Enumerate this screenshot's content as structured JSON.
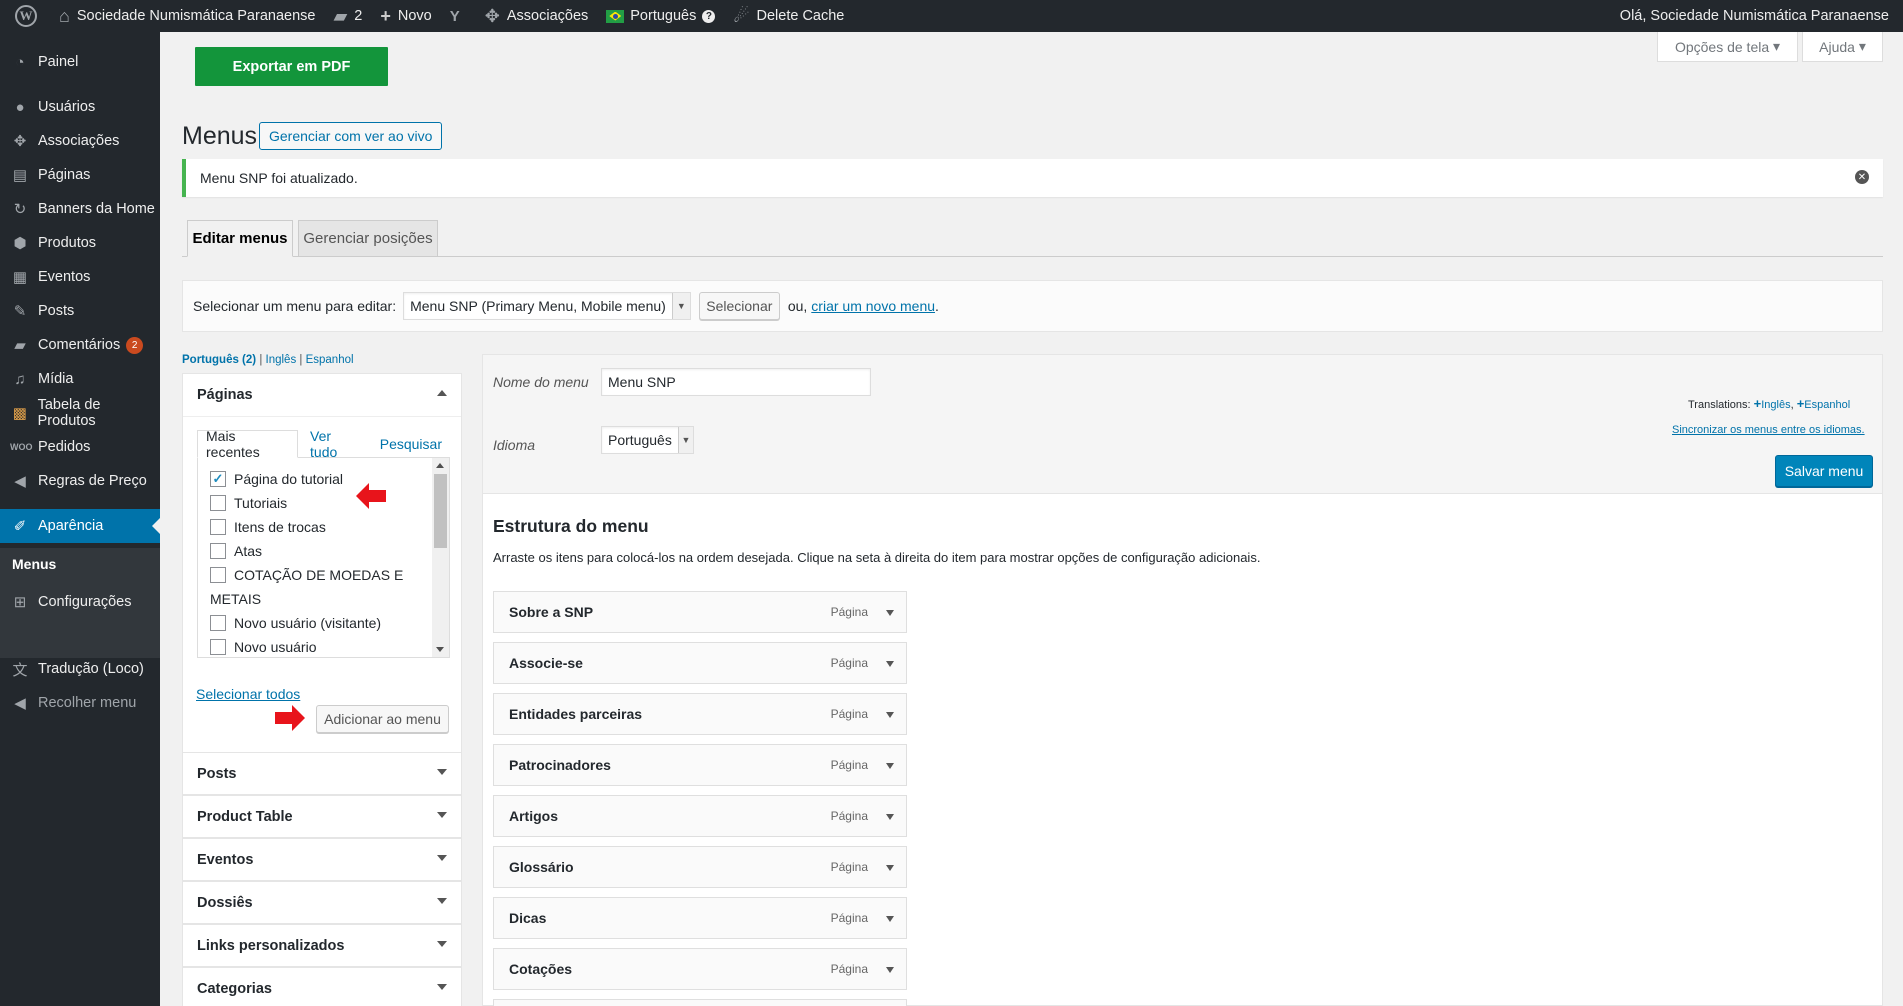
{
  "adminbar": {
    "site_name": "Sociedade Numismática Paranaense",
    "comments_count": "2",
    "new_label": "Novo",
    "associations": "Associações",
    "language": "Português",
    "delete_cache": "Delete Cache",
    "greeting": "Olá, Sociedade Numismática Paranaense"
  },
  "sidebar": {
    "painel": "Painel",
    "usuarios": "Usuários",
    "associacoes": "Associações",
    "paginas": "Páginas",
    "banners": "Banners da Home",
    "produtos": "Produtos",
    "eventos": "Eventos",
    "posts": "Posts",
    "comentarios": "Comentários",
    "comentarios_badge": "2",
    "midia": "Mídia",
    "tabela": "Tabela de Produtos",
    "pedidos": "Pedidos",
    "regras": "Regras de Preço",
    "aparencia": "Aparência",
    "menus": "Menus",
    "configuracoes": "Configurações",
    "traducao": "Tradução (Loco)",
    "recolher": "Recolher menu"
  },
  "header": {
    "export_pdf": "Exportar em PDF",
    "screen_options": "Opções de tela",
    "help": "Ajuda",
    "page_title": "Menus",
    "manage_live": "Gerenciar com ver ao vivo",
    "notice": "Menu SNP foi atualizado."
  },
  "tabs": {
    "edit": "Editar menus",
    "manage": "Gerenciar posições"
  },
  "select_menu": {
    "label": "Selecionar um menu para editar:",
    "value": "Menu SNP (Primary Menu, Mobile menu)",
    "button": "Selecionar",
    "or": "ou,",
    "create_link": "criar um novo menu",
    "period": "."
  },
  "languages": {
    "current": "Português (2)",
    "sep": " | ",
    "ingles": "Inglês",
    "espanhol": "Espanhol"
  },
  "paginas_box": {
    "title": "Páginas",
    "tab_recent": "Mais recentes",
    "tab_all": "Ver tudo",
    "tab_search": "Pesquisar",
    "items": [
      {
        "label": "Página do tutorial",
        "checked": true
      },
      {
        "label": "Tutoriais",
        "checked": false
      },
      {
        "label": "Itens de trocas",
        "checked": false
      },
      {
        "label": "Atas",
        "checked": false
      },
      {
        "label": "COTAÇÃO DE MOEDAS E",
        "checked": false
      },
      {
        "label": "Novo usuário (visitante)",
        "checked": false
      },
      {
        "label": "Novo usuário",
        "checked": false
      }
    ],
    "item_wrap": "METAIS",
    "select_all": "Selecionar todos",
    "add_button": "Adicionar ao menu"
  },
  "accordions": [
    "Posts",
    "Product Table",
    "Eventos",
    "Dossiês",
    "Links personalizados",
    "Categorias"
  ],
  "menu_edit": {
    "name_label": "Nome do menu",
    "name_value": "Menu SNP",
    "lang_label": "Idioma",
    "lang_value": "Português",
    "translations_label": "Translations:",
    "translation_en": "Inglês",
    "translation_es": "Espanhol",
    "translation_comma": ",",
    "sync_link": "Sincronizar os menus entre os idiomas.",
    "save": "Salvar menu",
    "structure_title": "Estrutura do menu",
    "structure_desc": "Arraste os itens para colocá-los na ordem desejada. Clique na seta à direita do item para mostrar opções de configuração adicionais.",
    "item_type": "Página",
    "items": [
      "Sobre a SNP",
      "Associe-se",
      "Entidades parceiras",
      "Patrocinadores",
      "Artigos",
      "Glossário",
      "Dicas",
      "Cotações"
    ]
  },
  "colors": {
    "adminbar": "#23282d",
    "accent": "#0073aa",
    "export_green": "#13953b",
    "annotation_red": "#e8141b"
  }
}
